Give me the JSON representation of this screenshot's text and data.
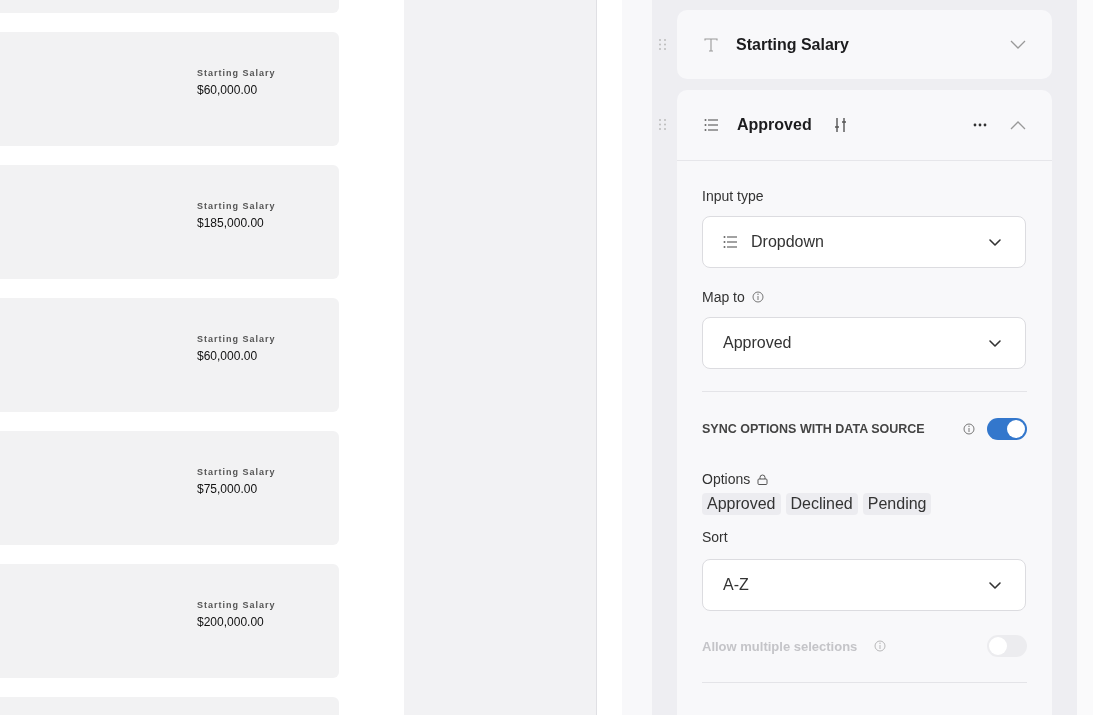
{
  "cards": [
    {
      "kind": "partial"
    },
    {
      "kind": "salary",
      "label": "Starting Salary",
      "value": "$60,000.00"
    },
    {
      "kind": "salary",
      "label": "Starting Salary",
      "value": "$185,000.00"
    },
    {
      "kind": "salary",
      "label": "Starting Salary",
      "value": "$60,000.00"
    },
    {
      "kind": "salary",
      "label": "Starting Salary",
      "value": "$75,000.00"
    },
    {
      "kind": "salary",
      "label": "Starting Salary",
      "value": "$200,000.00"
    },
    {
      "kind": "partial"
    }
  ],
  "fields": [
    {
      "kind": "text",
      "title": "Starting Salary",
      "expanded": false
    },
    {
      "kind": "list",
      "title": "Approved",
      "expanded": true,
      "input_type": {
        "label": "Input type",
        "value": "Dropdown"
      },
      "map_to": {
        "label": "Map to",
        "value": "Approved"
      },
      "sync": {
        "label": "SYNC OPTIONS WITH DATA SOURCE",
        "on": true
      },
      "options": {
        "label": "Options",
        "items": [
          "Approved",
          "Declined",
          "Pending"
        ]
      },
      "sort": {
        "label": "Sort",
        "value": "A-Z"
      },
      "multiple": {
        "label": "Allow multiple selections",
        "on": false,
        "disabled": true
      }
    }
  ]
}
